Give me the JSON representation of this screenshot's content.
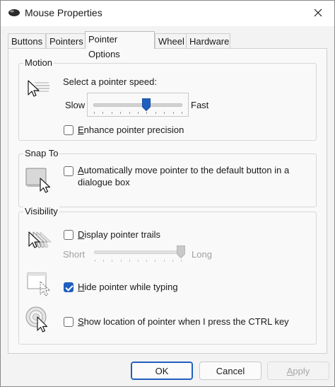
{
  "window": {
    "title": "Mouse Properties",
    "close_glyph": "✕"
  },
  "tabs": [
    {
      "label": "Buttons"
    },
    {
      "label": "Pointers"
    },
    {
      "label": "Pointer Options",
      "active": true
    },
    {
      "label": "Wheel"
    },
    {
      "label": "Hardware"
    }
  ],
  "motion": {
    "group_label": "Motion",
    "speed_label": "Select a pointer speed:",
    "slow_label": "Slow",
    "fast_label": "Fast",
    "speed_value": 0.6,
    "precision_label": "Enhance pointer precision",
    "precision_checked": false
  },
  "snap": {
    "group_label": "Snap To",
    "label_line1": "Automatically move pointer to the default button in a",
    "label_line2": "dialogue box",
    "checked": false
  },
  "visibility": {
    "group_label": "Visibility",
    "trails_label": "Display pointer trails",
    "trails_checked": false,
    "short_label": "Short",
    "long_label": "Long",
    "trails_value": 1.0,
    "hide_label": "Hide pointer while typing",
    "hide_checked": true,
    "show_label": "Show location of pointer when I press the CTRL key",
    "show_checked": false
  },
  "buttons": {
    "ok": "OK",
    "cancel": "Cancel",
    "apply": "Apply"
  },
  "colors": {
    "accent": "#1f5fbf",
    "window_bg": "#f3f3f3",
    "panel_bg": "#f9f9f9"
  }
}
